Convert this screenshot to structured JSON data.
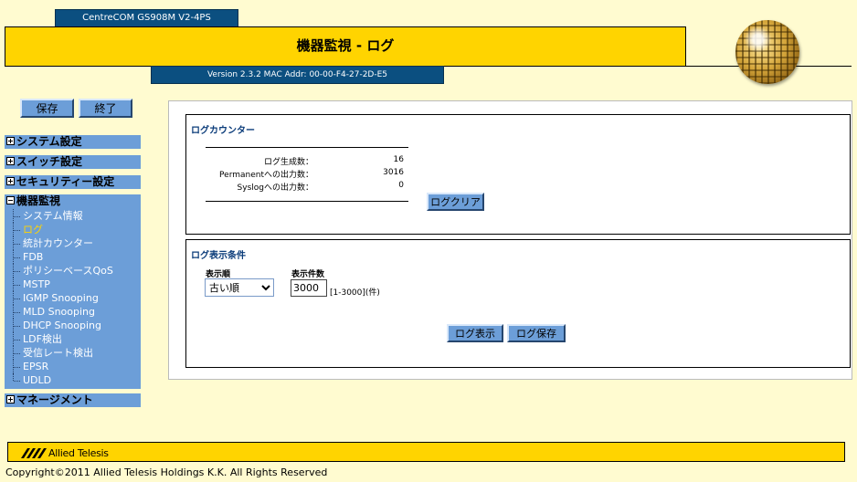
{
  "header": {
    "model": "CentreCOM GS908M V2-4PS",
    "title": "機器監視 - ログ",
    "version": "Version 2.3.2 MAC Addr: 00-00-F4-27-2D-E5"
  },
  "toolbar": {
    "save_label": "保存",
    "exit_label": "終了"
  },
  "sidebar": {
    "system": "システム設定",
    "switch": "スイッチ設定",
    "security": "セキュリティー設定",
    "monitor": {
      "label": "機器監視",
      "items": [
        "システム情報",
        "ログ",
        "統計カウンター",
        "FDB",
        "ポリシーベースQoS",
        "MSTP",
        "IGMP Snooping",
        "MLD Snooping",
        "DHCP Snooping",
        "LDF検出",
        "受信レート検出",
        "EPSR",
        "UDLD"
      ],
      "active_index": 1
    },
    "management": "マネージメント"
  },
  "log_counter": {
    "title": "ログカウンター",
    "rows": [
      {
        "label": "ログ生成数：",
        "value": "16"
      },
      {
        "label": "Permanentへの出力数：",
        "value": "3016"
      },
      {
        "label": "Syslogへの出力数：",
        "value": "0"
      }
    ],
    "clear_button": "ログクリア"
  },
  "log_display": {
    "title": "ログ表示条件",
    "order_label": "表示順",
    "order_value": "古い順",
    "count_label": "表示件数",
    "count_value": "3000",
    "count_range": "[1-3000](件)",
    "show_button": "ログ表示",
    "save_button": "ログ保存"
  },
  "footer": {
    "brand": "Allied Telesis",
    "copyright": "Copyright©2011 Allied Telesis Holdings K.K. All Rights Reserved"
  },
  "colors": {
    "accent_yellow": "#ffd400",
    "nav_blue": "#6c9ed8",
    "header_blue": "#0b4f80",
    "background": "#fffbd0"
  }
}
